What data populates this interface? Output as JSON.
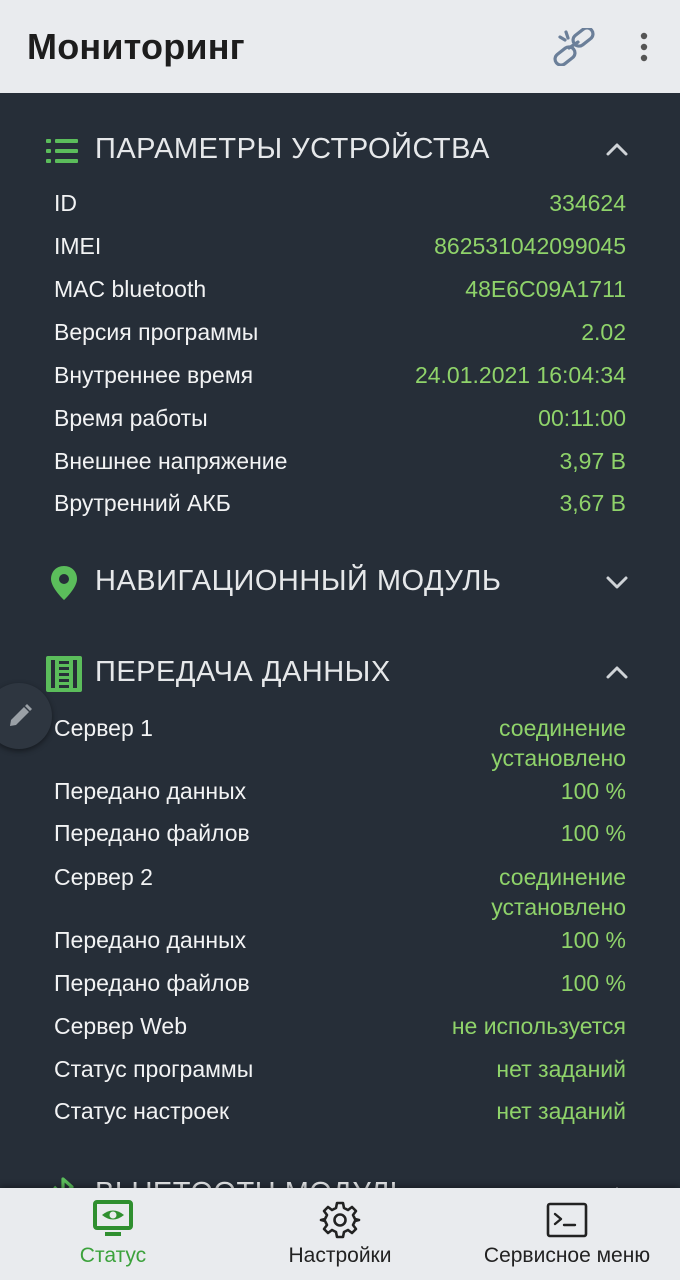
{
  "app": {
    "title": "Мониторинг",
    "accent": "#8fd36a",
    "active_color": "#3ca23c"
  },
  "device": {
    "title": "ПАРАМЕТРЫ УСТРОЙСТВА",
    "icon": "list-icon",
    "expanded": true,
    "rows": [
      {
        "label": "ID",
        "value": "334624"
      },
      {
        "label": "IMEI",
        "value": "862531042099045"
      },
      {
        "label": "MAC bluetooth",
        "value": "48E6C09A1711"
      },
      {
        "label": "Версия программы",
        "value": "2.02"
      },
      {
        "label": "Внутреннее время",
        "value": "24.01.2021 16:04:34"
      },
      {
        "label": "Время работы",
        "value": "00:11:00"
      },
      {
        "label": "Внешнее напряжение",
        "value": "3,97 В"
      },
      {
        "label": "Врутренний АКБ",
        "value": "3,67 В"
      }
    ]
  },
  "navigation": {
    "title": "НАВИГАЦИОННЫЙ МОДУЛЬ",
    "icon": "location-pin-icon",
    "expanded": false
  },
  "transfer": {
    "title": "ПЕРЕДАЧА ДАННЫХ",
    "icon": "server-icon",
    "expanded": true,
    "rows": [
      {
        "label": "Сервер 1",
        "value": "соединение установлено"
      },
      {
        "label": "Передано данных",
        "value": "100 %"
      },
      {
        "label": "Передано файлов",
        "value": "100 %"
      },
      {
        "label": "Сервер 2",
        "value": "соединение установлено"
      },
      {
        "label": "Передано данных",
        "value": "100 %"
      },
      {
        "label": "Передано файлов",
        "value": "100 %"
      },
      {
        "label": "Сервер Web",
        "value": "не используется"
      },
      {
        "label": "Статус программы",
        "value": "нет заданий"
      },
      {
        "label": "Статус настроек",
        "value": "нет заданий"
      }
    ]
  },
  "bluetooth": {
    "title": "BLUETOOTH МОДУЛЬ",
    "icon": "bluetooth-icon",
    "expanded": true
  },
  "bottom_nav": [
    {
      "label": "Статус",
      "icon": "monitor-eye-icon",
      "active": true
    },
    {
      "label": "Настройки",
      "icon": "gear-icon",
      "active": false
    },
    {
      "label": "Сервисное меню",
      "icon": "terminal-icon",
      "active": false
    }
  ]
}
